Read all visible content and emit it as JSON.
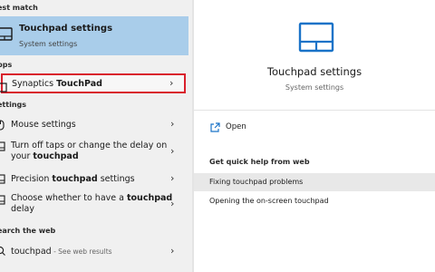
{
  "sections": {
    "best_match": "est match",
    "apps": "pps",
    "settings": "ettings",
    "web": "earch the web"
  },
  "best_match": {
    "title": "Touchpad settings",
    "subtitle": "System settings",
    "icon": "touchpad-icon"
  },
  "apps": [
    {
      "label_plain": "Synaptics ",
      "label_bold": "TouchPad",
      "icon": "app-icon",
      "highlighted": true
    }
  ],
  "settings": [
    {
      "line1_plain": "Mouse settings",
      "icon": "mouse-icon"
    },
    {
      "line1_plain": "Turn off taps or change the delay on",
      "line2_plain": "your ",
      "line2_bold": "touchpad",
      "icon": "touchpad-icon"
    },
    {
      "line1_plain": "Precision ",
      "line1_bold": "touchpad",
      "line1_tail": " settings",
      "icon": "touchpad-icon"
    },
    {
      "line1_plain": "Choose whether to have a ",
      "line1_bold": "touchpad",
      "line2_plain": "delay",
      "icon": "touchpad-icon"
    }
  ],
  "web": {
    "query": "touchpad",
    "suffix": " - See web results",
    "icon": "search-icon"
  },
  "details": {
    "title": "Touchpad settings",
    "subtitle": "System settings",
    "open_label": "Open",
    "help_heading": "Get quick help from web",
    "links": [
      "Fixing touchpad problems",
      "Opening the on-screen touchpad"
    ]
  },
  "colors": {
    "selected_bg": "#a9cdea",
    "highlight_border": "#d9202c",
    "accent": "#1a73c8"
  }
}
